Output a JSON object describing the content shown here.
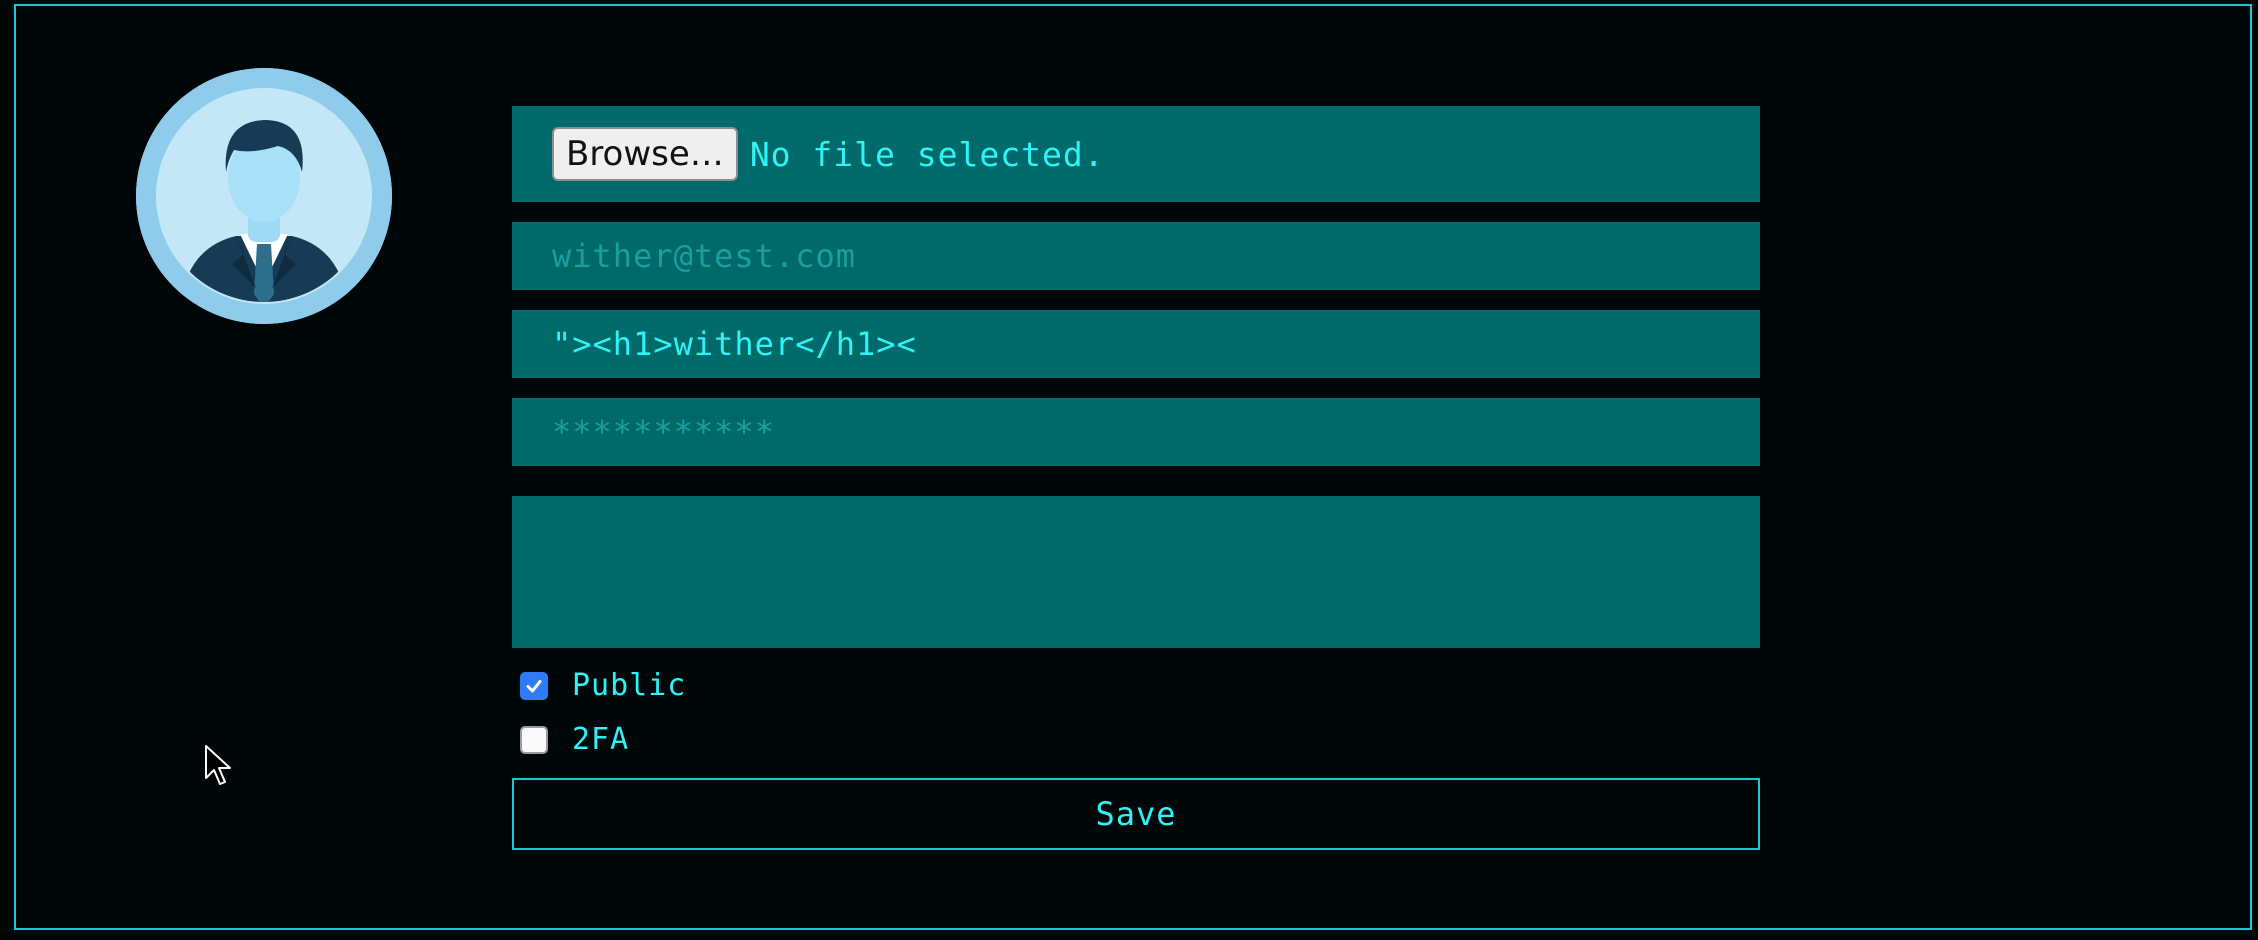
{
  "profile": {
    "avatar_icon": "user-avatar-icon"
  },
  "form": {
    "file": {
      "button_label": "Browse…",
      "status": "No file selected."
    },
    "email": {
      "placeholder": "wither@test.com",
      "value": ""
    },
    "name": {
      "value": "\"><h1>wither</h1><"
    },
    "password": {
      "placeholder": "***********",
      "value": ""
    },
    "bio": {
      "value": ""
    },
    "public": {
      "label": "Public",
      "checked": true
    },
    "twofa": {
      "label": "2FA",
      "checked": false
    },
    "save_label": "Save"
  },
  "colors": {
    "background": "#000708",
    "accent": "#19c9cf",
    "field_bg": "#006a6a",
    "text": "#2ef2f5"
  }
}
